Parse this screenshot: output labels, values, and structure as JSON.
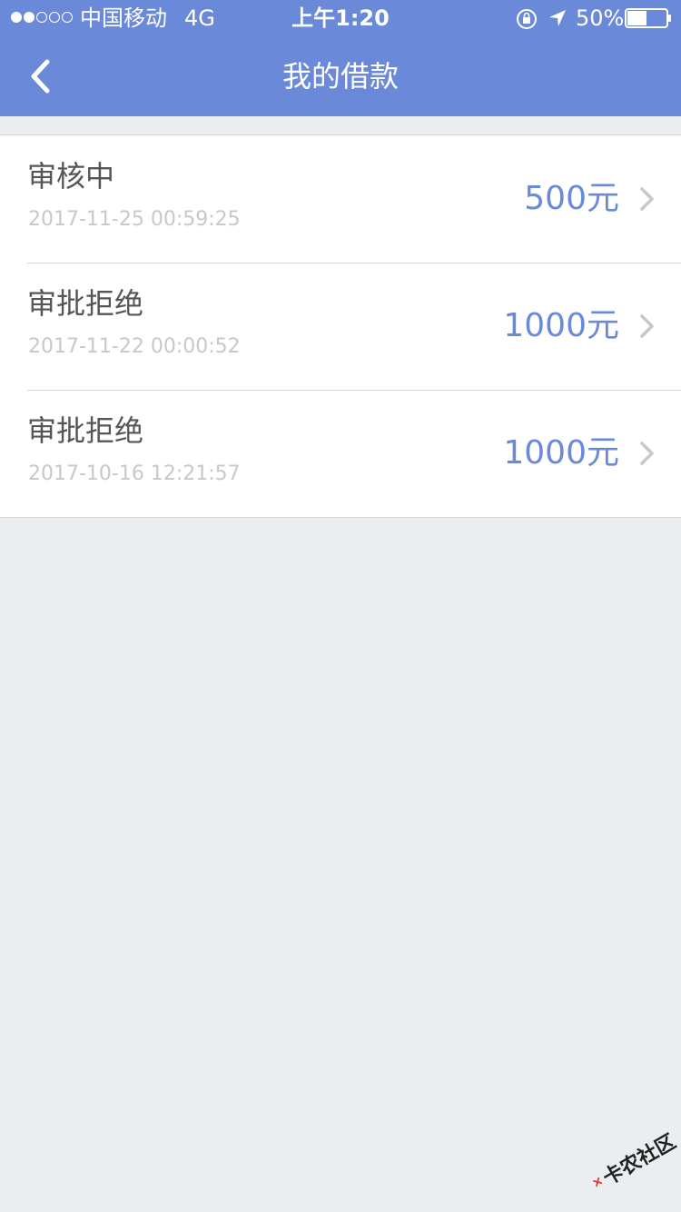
{
  "status_bar": {
    "carrier": "中国移动",
    "network": "4G",
    "time": "上午1:20",
    "battery_percent": "50%",
    "battery_level": 0.5,
    "signal_strength": 2,
    "signal_max": 5
  },
  "nav": {
    "title": "我的借款",
    "back_icon": "chevron-left-icon"
  },
  "loans": [
    {
      "status": "审核中",
      "date": "2017-11-25 00:59:25",
      "amount": "500元"
    },
    {
      "status": "审批拒绝",
      "date": "2017-11-22 00:00:52",
      "amount": "1000元"
    },
    {
      "status": "审批拒绝",
      "date": "2017-10-16 12:21:57",
      "amount": "1000元"
    }
  ],
  "watermark": {
    "text": "卡农社区"
  },
  "colors": {
    "accent": "#6b89d9",
    "background": "#eaeef0",
    "date_gray": "#c8c8c8",
    "status_gray": "#555555"
  }
}
